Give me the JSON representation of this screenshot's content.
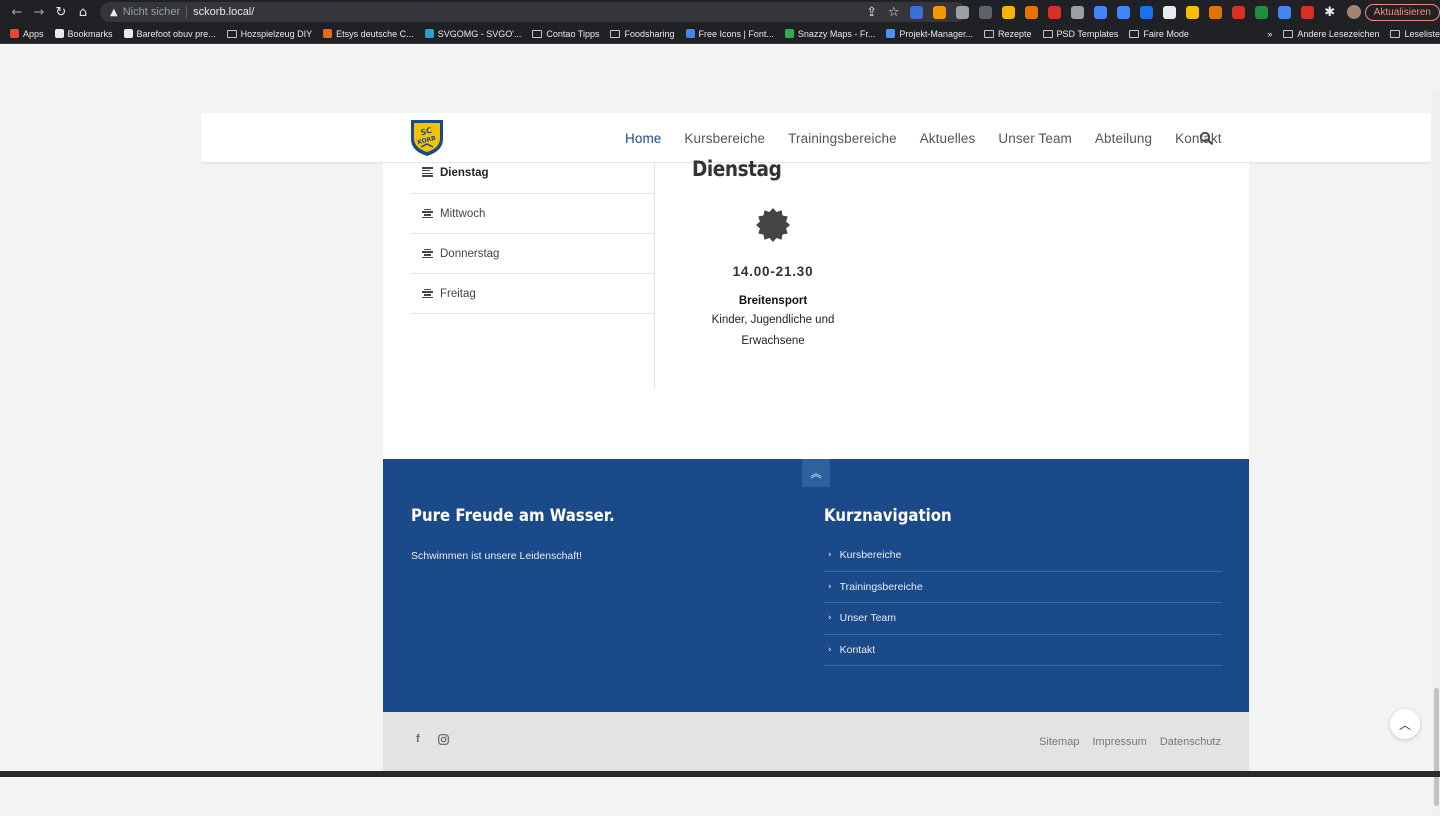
{
  "browser": {
    "security_label": "Nicht sicher",
    "url": "sckorb.local/",
    "update_label": "Aktualisieren",
    "bookmarks": [
      {
        "label": "Apps",
        "icon": "apps-grid-icon",
        "color": "#e8453c"
      },
      {
        "label": "Bookmarks",
        "icon": "star-icon",
        "color": "#e8eaed"
      },
      {
        "label": "Barefoot obuv pre...",
        "icon": "globe-icon",
        "color": "#e8eaed"
      },
      {
        "label": "Hozspielzeug DIY",
        "icon": "folder-icon",
        "color": "#c4c7c5"
      },
      {
        "label": "Etsys deutsche C...",
        "icon": "etsy-icon",
        "color": "#f1641e"
      },
      {
        "label": "SVGOMG - SVGO'...",
        "icon": "svgomg-icon",
        "color": "#2ca0c9"
      },
      {
        "label": "Contao Tipps",
        "icon": "folder-icon",
        "color": "#c4c7c5"
      },
      {
        "label": "Foodsharing",
        "icon": "folder-icon",
        "color": "#c4c7c5"
      },
      {
        "label": "Free Icons | Font...",
        "icon": "flag-icon",
        "color": "#4285f4"
      },
      {
        "label": "Snazzy Maps - Fr...",
        "icon": "map-pin-icon",
        "color": "#34a853"
      },
      {
        "label": "Projekt-Manager...",
        "icon": "project-icon",
        "color": "#4d90fe"
      },
      {
        "label": "Rezepte",
        "icon": "folder-icon",
        "color": "#c4c7c5"
      },
      {
        "label": "PSD Templates",
        "icon": "folder-icon",
        "color": "#c4c7c5"
      },
      {
        "label": "Faire Mode",
        "icon": "folder-icon",
        "color": "#c4c7c5"
      }
    ],
    "bookmarks_more": "»",
    "other_bookmarks": "Andere Lesezeichen",
    "reading_list": "Leseliste"
  },
  "header": {
    "logo_text": "SC KORB",
    "nav": [
      {
        "label": "Home",
        "active": true
      },
      {
        "label": "Kursbereiche",
        "active": false
      },
      {
        "label": "Trainingsbereiche",
        "active": false
      },
      {
        "label": "Aktuelles",
        "active": false
      },
      {
        "label": "Unser Team",
        "active": false
      },
      {
        "label": "Abteilung",
        "active": false
      },
      {
        "label": "Kontakt",
        "active": false
      }
    ]
  },
  "schedule": {
    "days": [
      {
        "label": "Dienstag",
        "active": true
      },
      {
        "label": "Mittwoch",
        "active": false
      },
      {
        "label": "Donnerstag",
        "active": false
      },
      {
        "label": "Freitag",
        "active": false
      }
    ],
    "title": "Dienstag",
    "entry": {
      "time": "14.00-21.30",
      "name": "Breitensport",
      "description": "Kinder, Jugendliche und Erwachsene"
    }
  },
  "footer": {
    "left_title": "Pure Freude am Wasser.",
    "left_text": "Schwimmen ist unsere Leidenschaft!",
    "right_title": "Kurznavigation",
    "links": [
      "Kursbereiche",
      "Trainingsbereiche",
      "Unser Team",
      "Kontakt"
    ],
    "social": [
      "facebook-icon",
      "instagram-icon"
    ],
    "legal": [
      "Sitemap",
      "Impressum",
      "Datenschutz"
    ]
  },
  "colors": {
    "brand_blue": "#1b4a8a",
    "logo_yellow": "#f5c400"
  }
}
